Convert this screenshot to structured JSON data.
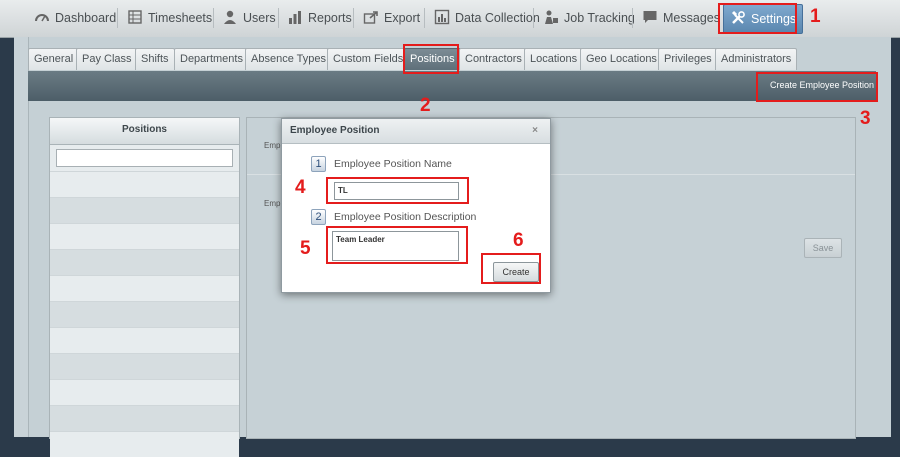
{
  "nav": {
    "items": [
      {
        "label": "Dashboard",
        "icon": "dashboard-icon"
      },
      {
        "label": "Timesheets",
        "icon": "timesheets-icon"
      },
      {
        "label": "Users",
        "icon": "user-icon"
      },
      {
        "label": "Reports",
        "icon": "bar-chart-icon"
      },
      {
        "label": "Export",
        "icon": "export-icon"
      },
      {
        "label": "Data Collection",
        "icon": "data-collection-icon"
      },
      {
        "label": "Job Tracking",
        "icon": "job-tracking-icon"
      },
      {
        "label": "Messages",
        "icon": "chat-bubble-icon"
      },
      {
        "label": "Settings",
        "icon": "tools-icon"
      }
    ]
  },
  "tabs": [
    "General",
    "Pay Class",
    "Shifts",
    "Departments",
    "Absence Types",
    "Custom Fields",
    "Positions",
    "Contractors",
    "Locations",
    "Geo Locations",
    "Privileges",
    "Administrators"
  ],
  "active_tab": "Positions",
  "toolbar": {
    "create_label": "Create Employee Position"
  },
  "left_panel": {
    "title": "Positions",
    "search_value": ""
  },
  "right_panel": {
    "label_1": "Emp",
    "label_2": "Emp",
    "save_label": "Save"
  },
  "dialog": {
    "title": "Employee Position",
    "close_glyph": "×",
    "step1_num": "1",
    "step1_label": "Employee Position Name",
    "name_value": "TL",
    "step2_num": "2",
    "step2_label": "Employee Position Description",
    "description_value": "Team Leader",
    "create_label": "Create"
  },
  "annotations": [
    "1",
    "2",
    "3",
    "4",
    "5",
    "6"
  ],
  "colors": {
    "annotation": "#e41c1c",
    "active_nav": "#5a86ae",
    "toolbar": "#4d5e68"
  }
}
